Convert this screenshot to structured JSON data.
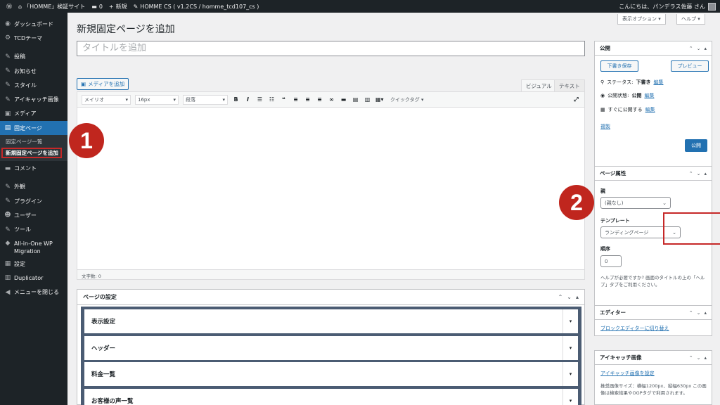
{
  "adminbar": {
    "site_name": "「HOMME」検証サイト",
    "comments_count": "0",
    "new_label": "新規",
    "theme_label": "HOMME CS ( v1.2CS / homme_tcd107_cs )",
    "greeting": "こんにちは、パンデラス佐藤 さん"
  },
  "sidebar": {
    "items": [
      {
        "icon": "dashboard-icon",
        "glyph": "◉",
        "label": "ダッシュボード"
      },
      {
        "icon": "tcd-icon",
        "glyph": "⚙",
        "label": "TCDテーマ"
      },
      {
        "icon": "posts-icon",
        "glyph": "✎",
        "label": "投稿"
      },
      {
        "icon": "news-icon",
        "glyph": "✎",
        "label": "お知らせ"
      },
      {
        "icon": "style-icon",
        "glyph": "✎",
        "label": "スタイル"
      },
      {
        "icon": "eyecatch-icon",
        "glyph": "✎",
        "label": "アイキャッチ画像"
      },
      {
        "icon": "media-icon",
        "glyph": "▣",
        "label": "メディア"
      },
      {
        "icon": "pages-icon",
        "glyph": "▤",
        "label": "固定ページ"
      }
    ],
    "submenu": {
      "list_label": "固定ページ一覧",
      "add_new_label": "新規固定ページを追加"
    },
    "items_after": [
      {
        "icon": "comments-icon",
        "glyph": "▬",
        "label": "コメント"
      },
      {
        "icon": "appearance-icon",
        "glyph": "✎",
        "label": "外観"
      },
      {
        "icon": "plugins-icon",
        "glyph": "✎",
        "label": "プラグイン"
      },
      {
        "icon": "users-icon",
        "glyph": "☻",
        "label": "ユーザー"
      },
      {
        "icon": "tools-icon",
        "glyph": "✎",
        "label": "ツール"
      }
    ],
    "migration_label_1": "All-in-One WP",
    "migration_label_2": "Migration",
    "settings_label": "設定",
    "duplicator_label": "Duplicator",
    "collapse_label": "メニューを閉じる"
  },
  "header": {
    "screen_options": "表示オプション ▾",
    "help": "ヘルプ ▾",
    "page_title": "新規固定ページを追加"
  },
  "editor": {
    "title_placeholder": "タイトルを追加",
    "add_media": "メディアを追加",
    "tab_visual": "ビジュアル",
    "tab_text": "テキスト",
    "font_family": "メイリオ",
    "font_size": "16px",
    "format": "段落",
    "quicktag": "クイックタグ ▾",
    "word_count": "文字数: 0"
  },
  "page_settings": {
    "title": "ページの設定",
    "rows": [
      "表示設定",
      "ヘッダー",
      "料金一覧",
      "お客様の声一覧"
    ]
  },
  "publish_box": {
    "title": "公開",
    "save_draft": "下書き保存",
    "preview": "プレビュー",
    "status_label": "ステータス:",
    "status_value": "下書き",
    "visibility_label": "公開状態:",
    "visibility_value": "公開",
    "schedule_label": "すぐに公開する",
    "edit_link": "編集",
    "trash": "複製",
    "publish_button": "公開"
  },
  "page_attributes": {
    "title": "ページ属性",
    "parent_label": "親",
    "parent_value": "(親なし)",
    "template_label": "テンプレート",
    "template_value": "ランディングページ",
    "order_label": "順序",
    "order_value": "0",
    "help_text": "ヘルプが必要ですか? 画面のタイトルの上の「ヘルプ」タブをご利用ください。"
  },
  "editor_box": {
    "title": "エディター",
    "link": "ブロックエディターに切り替え"
  },
  "eyecatch_box": {
    "title": "アイキャッチ画像",
    "link": "アイキャッチ画像を設定",
    "desc": "推奨画像サイズ：横幅1200px、縦幅630px この画像は検索結果やOGPタグで利用されます。"
  },
  "annotations": {
    "marker_1": "1",
    "marker_2": "2"
  },
  "colors": {
    "admin_dark": "#1d2327",
    "accent_blue": "#2271b1",
    "annotation_red": "#c0261e",
    "settings_panel": "#4b5c73"
  }
}
